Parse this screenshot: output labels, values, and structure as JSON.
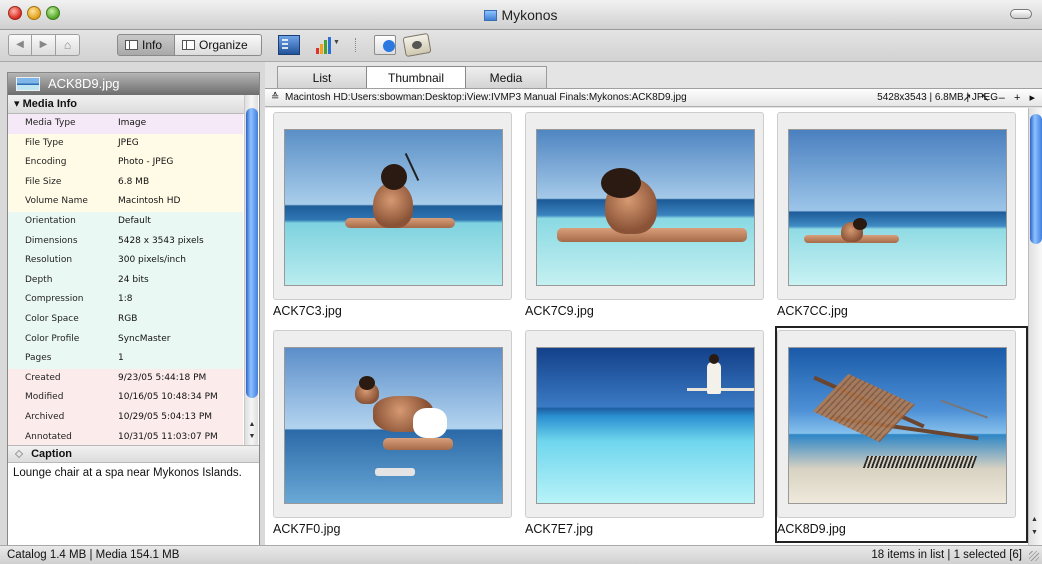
{
  "window": {
    "title": "Mykonos"
  },
  "toolbar": {
    "info_label": "Info",
    "organize_label": "Organize",
    "back_icon": "◀",
    "forward_icon": "▶",
    "home_icon": "⌂"
  },
  "info_panel": {
    "file_name": "ACK8D9.jpg",
    "media_info_title": "Media Info",
    "rows": [
      {
        "label": "Media Type",
        "value": "Image",
        "color": "#f6e9f7"
      },
      {
        "label": "File Type",
        "value": "JPEG",
        "color": "#fffbe6"
      },
      {
        "label": "Encoding",
        "value": "Photo - JPEG",
        "color": "#fffbe6"
      },
      {
        "label": "File Size",
        "value": "6.8 MB",
        "color": "#fffbe6"
      },
      {
        "label": "Volume Name",
        "value": "Macintosh HD",
        "color": "#fffbe6"
      },
      {
        "label": "Orientation",
        "value": "Default",
        "color": "#eaf8f4"
      },
      {
        "label": "Dimensions",
        "value": "5428 x 3543 pixels",
        "color": "#eaf8f4"
      },
      {
        "label": "Resolution",
        "value": "300 pixels/inch",
        "color": "#eaf8f4"
      },
      {
        "label": "Depth",
        "value": "24 bits",
        "color": "#eaf8f4"
      },
      {
        "label": "Compression",
        "value": "1:8",
        "color": "#eaf8f4"
      },
      {
        "label": "Color Space",
        "value": "RGB",
        "color": "#eaf8f4"
      },
      {
        "label": "Color Profile",
        "value": "SyncMaster",
        "color": "#eaf8f4"
      },
      {
        "label": "Pages",
        "value": "1",
        "color": "#eaf8f4"
      },
      {
        "label": "Created",
        "value": "9/23/05 5:44:18 PM",
        "color": "#fbeceb"
      },
      {
        "label": "Modified",
        "value": "10/16/05 10:48:34 PM",
        "color": "#fbeceb"
      },
      {
        "label": "Archived",
        "value": "10/29/05 5:04:13 PM",
        "color": "#fbeceb"
      },
      {
        "label": "Annotated",
        "value": "10/31/05 11:03:07 PM",
        "color": "#fbeceb"
      }
    ],
    "caption_title": "Caption",
    "caption_text": "Lounge chair at a spa near Mykonos Islands."
  },
  "tabs": [
    {
      "label": "List"
    },
    {
      "label": "Thumbnail"
    },
    {
      "label": "Media"
    }
  ],
  "pathbar": {
    "path": "Macintosh HD:Users:sbowman:Desktop:iView:IVMP3 Manual Finals:Mykonos:ACK8D9.jpg",
    "info": "5428x3543  |  6.8MB  |  JPEG",
    "controls": "↗ ↖ – + ▸"
  },
  "thumbnails": [
    {
      "name": "ACK7C3.jpg",
      "selected": false
    },
    {
      "name": "ACK7C9.jpg",
      "selected": false
    },
    {
      "name": "ACK7CC.jpg",
      "selected": false
    },
    {
      "name": "ACK7F0.jpg",
      "selected": false
    },
    {
      "name": "ACK7E7.jpg",
      "selected": false
    },
    {
      "name": "ACK8D9.jpg",
      "selected": true
    }
  ],
  "status": {
    "left": "Catalog  1.4 MB  |  Media 154.1 MB",
    "right": "18 items in list  |  1 selected [6]"
  }
}
